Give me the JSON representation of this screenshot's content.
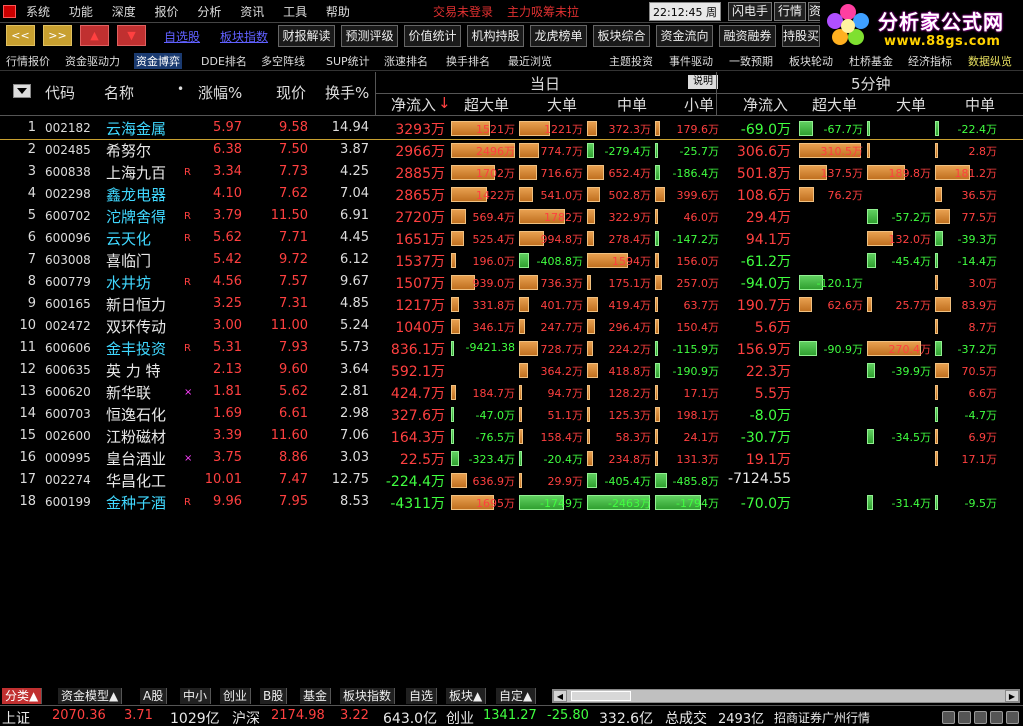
{
  "menubar": {
    "items": [
      "系统",
      "功能",
      "深度",
      "报价",
      "分析",
      "资讯",
      "工具",
      "帮助"
    ],
    "warning1": "交易未登录",
    "warning2": "主力吸筹未拉",
    "clock": "22:12:45 周二",
    "buttons": [
      "闪电手",
      "行情",
      "资"
    ]
  },
  "brand": {
    "line1": "分析家公式网",
    "line2": "www.88gs.com"
  },
  "toolbar": {
    "nav": [
      "<<",
      ">>",
      "▲",
      "▼"
    ],
    "links": [
      "自选股",
      "板块指数"
    ],
    "buttons": [
      "财报解读",
      "预测评级",
      "价值统计",
      "机构持股",
      "龙虎榜单",
      "板块综合",
      "资金流向",
      "融资融券",
      "持股买卖"
    ]
  },
  "subtabs": {
    "left": [
      "行情报价",
      "资金驱动力",
      "资金博弈",
      "DDE排名",
      "多空阵线",
      "SUP统计",
      "涨速排名",
      "换手排名",
      "最近浏览"
    ],
    "active": "资金博弈",
    "right": [
      "主题投资",
      "事件驱动",
      "一致预期",
      "板块轮动",
      "杜桥基金",
      "经济指标",
      "数据纵览"
    ]
  },
  "header": {
    "code": "代码",
    "name": "名称",
    "dot": "•",
    "chg": "涨幅%",
    "price": "现价",
    "turnover": "换手%",
    "today": "当日",
    "explain": "说明",
    "five": "5分钟",
    "net": "净流入",
    "sort_arrow": "↓",
    "xl": "超大单",
    "l": "大单",
    "m": "中单",
    "s": "小单",
    "net5": "净流入",
    "xl5": "超大单",
    "l5": "大单",
    "m5": "中单"
  },
  "rows": [
    {
      "idx": "1",
      "code": "002182",
      "name": "云海金属",
      "nc": "cyan",
      "flag": "",
      "chg": "5.97",
      "price": "9.58",
      "turn": "14.94",
      "net": "3293万",
      "netc": "red",
      "xl": "1521万",
      "xlv": 1521,
      "l": "1221万",
      "lv": 1221,
      "m": "372.3万",
      "mv": 372,
      "s": "179.6万",
      "sv": 180,
      "net5": "-69.0万",
      "net5c": "green",
      "xl5": "-67.7万",
      "xl5v": -68,
      "l5": "",
      "l5v": -2,
      "m5": "-22.4万",
      "m5v": -22
    },
    {
      "idx": "2",
      "code": "002485",
      "name": "希努尔",
      "nc": "white",
      "flag": "",
      "chg": "6.38",
      "price": "7.50",
      "turn": "3.87",
      "net": "2966万",
      "netc": "red",
      "xl": "2496万",
      "xlv": 2496,
      "l": "774.7万",
      "lv": 775,
      "m": "-279.4万",
      "mv": -279,
      "s": "-25.7万",
      "sv": -26,
      "net5": "306.6万",
      "net5c": "red",
      "xl5": "310.5万",
      "xl5v": 310,
      "l5": "",
      "l5v": 2,
      "m5": "2.8万",
      "m5v": 3
    },
    {
      "idx": "3",
      "code": "600838",
      "name": "上海九百",
      "nc": "white",
      "flag": "R",
      "chg": "3.34",
      "price": "7.73",
      "turn": "4.25",
      "net": "2885万",
      "netc": "red",
      "xl": "1702万",
      "xlv": 1702,
      "l": "716.6万",
      "lv": 717,
      "m": "652.4万",
      "mv": 652,
      "s": "-186.4万",
      "sv": -186,
      "net5": "501.8万",
      "net5c": "red",
      "xl5": "137.5万",
      "xl5v": 138,
      "l5": "189.8万",
      "l5v": 190,
      "m5": "181.2万",
      "m5v": 181
    },
    {
      "idx": "4",
      "code": "002298",
      "name": "鑫龙电器",
      "nc": "cyan",
      "flag": "",
      "chg": "4.10",
      "price": "7.62",
      "turn": "7.04",
      "net": "2865万",
      "netc": "red",
      "xl": "1422万",
      "xlv": 1422,
      "l": "541.0万",
      "lv": 541,
      "m": "502.8万",
      "mv": 503,
      "s": "399.6万",
      "sv": 400,
      "net5": "108.6万",
      "net5c": "red",
      "xl5": "76.2万",
      "xl5v": 76,
      "l5": "",
      "l5v": 0,
      "m5": "36.5万",
      "m5v": 36
    },
    {
      "idx": "5",
      "code": "600702",
      "name": "沱牌舍得",
      "nc": "cyan",
      "flag": "R",
      "chg": "3.79",
      "price": "11.50",
      "turn": "6.91",
      "net": "2720万",
      "netc": "red",
      "xl": "569.4万",
      "xlv": 569,
      "l": "1782万",
      "lv": 1782,
      "m": "322.9万",
      "mv": 323,
      "s": "46.0万",
      "sv": 46,
      "net5": "29.4万",
      "net5c": "red",
      "xl5": "",
      "xl5v": 0,
      "l5": "-57.2万",
      "l5v": -57,
      "m5": "77.5万",
      "m5v": 77
    },
    {
      "idx": "6",
      "code": "600096",
      "name": "云天化",
      "nc": "cyan",
      "flag": "R",
      "chg": "5.62",
      "price": "7.71",
      "turn": "4.45",
      "net": "1651万",
      "netc": "red",
      "xl": "525.4万",
      "xlv": 525,
      "l": "994.8万",
      "lv": 995,
      "m": "278.4万",
      "mv": 278,
      "s": "-147.2万",
      "sv": -147,
      "net5": "94.1万",
      "net5c": "red",
      "xl5": "",
      "xl5v": 0,
      "l5": "132.0万",
      "l5v": 132,
      "m5": "-39.3万",
      "m5v": -39
    },
    {
      "idx": "7",
      "code": "603008",
      "name": "喜临门",
      "nc": "white",
      "flag": "",
      "chg": "5.42",
      "price": "9.72",
      "turn": "6.12",
      "net": "1537万",
      "netc": "red",
      "xl": "196.0万",
      "xlv": 196,
      "l": "-408.8万",
      "lv": -409,
      "m": "1594万",
      "mv": 1594,
      "s": "156.0万",
      "sv": 156,
      "net5": "-61.2万",
      "net5c": "green",
      "xl5": "",
      "xl5v": 0,
      "l5": "-45.4万",
      "l5v": -45,
      "m5": "-14.4万",
      "m5v": -14
    },
    {
      "idx": "8",
      "code": "600779",
      "name": "水井坊",
      "nc": "cyan",
      "flag": "R",
      "chg": "4.56",
      "price": "7.57",
      "turn": "9.67",
      "net": "1507万",
      "netc": "red",
      "xl": "939.0万",
      "xlv": 939,
      "l": "736.3万",
      "lv": 736,
      "m": "175.1万",
      "mv": 175,
      "s": "257.0万",
      "sv": 257,
      "net5": "-94.0万",
      "net5c": "green",
      "xl5": "-120.1万",
      "xl5v": -120,
      "l5": "",
      "l5v": 0,
      "m5": "3.0万",
      "m5v": 3
    },
    {
      "idx": "9",
      "code": "600165",
      "name": "新日恒力",
      "nc": "white",
      "flag": "",
      "chg": "3.25",
      "price": "7.31",
      "turn": "4.85",
      "net": "1217万",
      "netc": "red",
      "xl": "331.8万",
      "xlv": 332,
      "l": "401.7万",
      "lv": 402,
      "m": "419.4万",
      "mv": 419,
      "s": "63.7万",
      "sv": 64,
      "net5": "190.7万",
      "net5c": "red",
      "xl5": "62.6万",
      "xl5v": 63,
      "l5": "25.7万",
      "l5v": 26,
      "m5": "83.9万",
      "m5v": 84
    },
    {
      "idx": "10",
      "code": "002472",
      "name": "双环传动",
      "nc": "white",
      "flag": "",
      "chg": "3.00",
      "price": "11.00",
      "turn": "5.24",
      "net": "1040万",
      "netc": "red",
      "xl": "346.1万",
      "xlv": 346,
      "l": "247.7万",
      "lv": 248,
      "m": "296.4万",
      "mv": 296,
      "s": "150.4万",
      "sv": 150,
      "net5": "5.6万",
      "net5c": "red",
      "xl5": "",
      "xl5v": 0,
      "l5": "",
      "l5v": 0,
      "m5": "8.7万",
      "m5v": 9
    },
    {
      "idx": "11",
      "code": "600606",
      "name": "金丰投资",
      "nc": "cyan",
      "flag": "R",
      "chg": "5.31",
      "price": "7.93",
      "turn": "5.73",
      "net": "836.1万",
      "netc": "red",
      "xl": "-9421.38",
      "xlv": -9,
      "l": "728.7万",
      "lv": 729,
      "m": "224.2万",
      "mv": 224,
      "s": "-115.9万",
      "sv": -116,
      "net5": "156.9万",
      "net5c": "red",
      "xl5": "-90.9万",
      "xl5v": -91,
      "l5": "270.4万",
      "l5v": 270,
      "m5": "-37.2万",
      "m5v": -37
    },
    {
      "idx": "12",
      "code": "600635",
      "name": "英 力 特",
      "nc": "white",
      "flag": "",
      "chg": "2.13",
      "price": "9.60",
      "turn": "3.64",
      "net": "592.1万",
      "netc": "red",
      "xl": "",
      "xlv": 0,
      "l": "364.2万",
      "lv": 364,
      "m": "418.8万",
      "mv": 419,
      "s": "-190.9万",
      "sv": -191,
      "net5": "22.3万",
      "net5c": "red",
      "xl5": "",
      "xl5v": 0,
      "l5": "-39.9万",
      "l5v": -40,
      "m5": "70.5万",
      "m5v": 70
    },
    {
      "idx": "13",
      "code": "600620",
      "name": "新华联",
      "nc": "white",
      "flag": "×",
      "chg": "1.81",
      "price": "5.62",
      "turn": "2.81",
      "net": "424.7万",
      "netc": "red",
      "xl": "184.7万",
      "xlv": 185,
      "l": "94.7万",
      "lv": 95,
      "m": "128.2万",
      "mv": 128,
      "s": "17.1万",
      "sv": 17,
      "net5": "5.5万",
      "net5c": "red",
      "xl5": "",
      "xl5v": 0,
      "l5": "",
      "l5v": 0,
      "m5": "6.6万",
      "m5v": 7
    },
    {
      "idx": "14",
      "code": "600703",
      "name": "恒逸石化",
      "nc": "white",
      "flag": "",
      "chg": "1.69",
      "price": "6.61",
      "turn": "2.98",
      "net": "327.6万",
      "netc": "red",
      "xl": "-47.0万",
      "xlv": -47,
      "l": "51.1万",
      "lv": 51,
      "m": "125.3万",
      "mv": 125,
      "s": "198.1万",
      "sv": 198,
      "net5": "-8.0万",
      "net5c": "green",
      "xl5": "",
      "xl5v": 0,
      "l5": "",
      "l5v": 0,
      "m5": "-4.7万",
      "m5v": -5
    },
    {
      "idx": "15",
      "code": "002600",
      "name": "江粉磁材",
      "nc": "white",
      "flag": "",
      "chg": "3.39",
      "price": "11.60",
      "turn": "7.06",
      "net": "164.3万",
      "netc": "red",
      "xl": "-76.5万",
      "xlv": -77,
      "l": "158.4万",
      "lv": 158,
      "m": "58.3万",
      "mv": 58,
      "s": "24.1万",
      "sv": 24,
      "net5": "-30.7万",
      "net5c": "green",
      "xl5": "",
      "xl5v": 0,
      "l5": "-34.5万",
      "l5v": -35,
      "m5": "6.9万",
      "m5v": 7
    },
    {
      "idx": "16",
      "code": "000995",
      "name": "皇台酒业",
      "nc": "white",
      "flag": "×",
      "chg": "3.75",
      "price": "8.86",
      "turn": "3.03",
      "net": "22.5万",
      "netc": "red",
      "xl": "-323.4万",
      "xlv": -323,
      "l": "-20.4万",
      "lv": -20,
      "m": "234.8万",
      "mv": 235,
      "s": "131.3万",
      "sv": 131,
      "net5": "19.1万",
      "net5c": "red",
      "xl5": "",
      "xl5v": 0,
      "l5": "",
      "l5v": 0,
      "m5": "17.1万",
      "m5v": 17
    },
    {
      "idx": "17",
      "code": "002274",
      "name": "华昌化工",
      "nc": "white",
      "flag": "",
      "chg": "10.01",
      "price": "7.47",
      "turn": "12.75",
      "net": "-224.4万",
      "netc": "green",
      "xl": "636.9万",
      "xlv": 637,
      "l": "29.9万",
      "lv": 30,
      "m": "-405.4万",
      "mv": -405,
      "s": "-485.8万",
      "sv": -486,
      "net5": "-7124.55",
      "net5c": "white",
      "xl5": "",
      "xl5v": 0,
      "l5": "",
      "l5v": 0,
      "m5": "",
      "m5v": 0
    },
    {
      "idx": "18",
      "code": "600199",
      "name": "金种子酒",
      "nc": "cyan",
      "flag": "R",
      "chg": "9.96",
      "price": "7.95",
      "turn": "8.53",
      "net": "-4311万",
      "netc": "green",
      "xl": "1695万",
      "xlv": 1695,
      "l": "-1749万",
      "lv": -1749,
      "m": "-2463万",
      "mv": -2463,
      "s": "-1794万",
      "sv": -1794,
      "net5": "-70.0万",
      "net5c": "green",
      "xl5": "",
      "xl5v": 0,
      "l5": "-31.4万",
      "l5v": -31,
      "m5": "-9.5万",
      "m5v": -10
    }
  ],
  "bottom_tabs": [
    "分类▲",
    "资金模型▲",
    "A股",
    "中小",
    "创业",
    "B股",
    "基金",
    "板块指数",
    "自选",
    "板块▲",
    "自定▲"
  ],
  "status": {
    "sh_label": "上证",
    "sh_val": "2070.36",
    "sh_chg": "3.71",
    "sh_amt": "1029亿",
    "hs_label": "沪深",
    "hs_val": "2174.98",
    "hs_chg": "3.22",
    "hs_amt": "643.0亿",
    "cy_label": "创业",
    "cy_val": "1341.27",
    "cy_chg": "-25.80",
    "cy_amt": "332.6亿",
    "total_label": "总成交",
    "total_val": "2493亿",
    "broker": "招商证券广州行情"
  }
}
